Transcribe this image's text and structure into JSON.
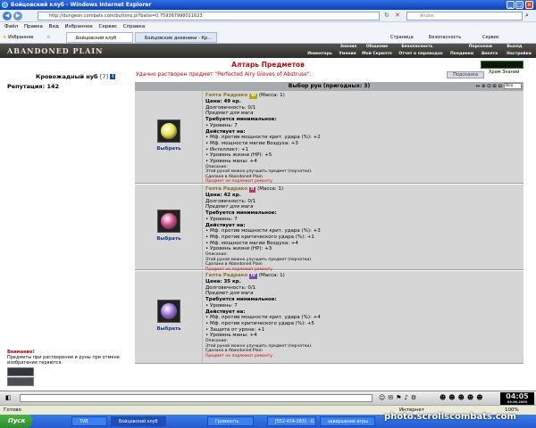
{
  "window": {
    "title": "Бойцовский клуб - Windows Internet Explorer",
    "min": "_",
    "max": "□",
    "close": "✕"
  },
  "address": {
    "url": "http://dungeon.combats.com/buttons.pl?batle=0.759367998011623",
    "search_placeholder": "Яndex"
  },
  "menu": [
    "Файл",
    "Правка",
    "Вид",
    "Избранное",
    "Сервис",
    "Справка"
  ],
  "tabs": {
    "favorites": "Избранное",
    "items": [
      "Бойцовский клуб",
      "Бойцовские дневники - Кр..."
    ]
  },
  "toolbar": {
    "page": "Страница",
    "safety": "Безопасность",
    "service": "Сервис"
  },
  "game": {
    "logo": "ABANDONED PLAIN",
    "nav_top": [
      "Знания",
      "Общение",
      "Безопасность",
      "Персонаж",
      "Выход"
    ],
    "nav_bottom": [
      "Инвентарь",
      "Умения",
      "Мой Скриптп",
      "Отчет о переводах",
      "Поединки",
      "Анкета",
      "Настройки"
    ]
  },
  "player": {
    "name": "Кровожадный нуб",
    "level": "[7]",
    "info_icon": "i",
    "reputation": "Репутация: 142"
  },
  "warning": {
    "title": "Внимание!",
    "text": "Предметы при растворении и руны при отмене изобратения теряются."
  },
  "page": {
    "title": "Алтарь Предметов",
    "message": "Удачно растворен предмет \"Perfected Airy Gloves of Abstruse\".",
    "help_button": "Подсказка",
    "zone": "Храм Знаний",
    "list_title": "Выбор рун (пригодных: 3)",
    "list_select": "Все",
    "list_icons": "↔ ⊕ Q ⊞ ⊟"
  },
  "runes": [
    {
      "name": "Гепта Радрако",
      "level_badge": "VI",
      "badge_color": "#b7a416",
      "mass": "(Масса: 1)",
      "price": "Цена: 49 кр.",
      "durability": "Долговечность: 0/1",
      "for_class": "Предмет для мага",
      "req_title": "Требуется минимальное:",
      "reqs": [
        "• Уровень: 7"
      ],
      "acts_title": "Действует на:",
      "effects": [
        "• Мф. против мощности крит. удара (%): +2",
        "• Мф. мощности магии Воздуха: +3",
        "• Интеллект: +1",
        "• Уровень жизни (HP): +5",
        "• Уровень маны: +4"
      ],
      "desc_title": "Описание:",
      "desc": "Этой руной можно улучшить предмет (перчатки).",
      "made": "Сделано в Abandoned Plain",
      "no_repair": "Предмет не подлежит ремонту",
      "choose": "Выбрать",
      "gem_color": "#e6e34a"
    },
    {
      "name": "Гепта Радрако",
      "level_badge": "II",
      "badge_color": "#b23a6c",
      "mass": "(Масса: 1)",
      "price": "Цена: 42 кр.",
      "durability": "Долговечность: 0/1",
      "for_class": "Предмет для мага",
      "req_title": "Требуется минимальное:",
      "reqs": [
        "• Уровень: 7"
      ],
      "acts_title": "Действует на:",
      "effects": [
        "• Мф. против мощности крит. удара (%): +3",
        "• Мф. против критического удара (%): +1",
        "• Мф. мощности магии Воздуха: +4",
        "• Уровень жизни (HP): +3"
      ],
      "desc_title": "Описание:",
      "desc": "Этой руной можно улучшить предмет (перчатки).",
      "made": "Сделано в Abandoned Plain",
      "no_repair": "Предмет не подлежит ремонту",
      "choose": "Выбрать",
      "gem_color": "#d04a8a"
    },
    {
      "name": "Гепта Радрако",
      "level_badge": "IV",
      "badge_color": "#7a4aa8",
      "mass": "(Масса: 1)",
      "price": "Цена: 35 кр.",
      "durability": "Долговечность: 0/1",
      "for_class": "Предмет для мага",
      "req_title": "Требуется минимальное:",
      "reqs": [
        "• Уровень: 7"
      ],
      "acts_title": "Действует на:",
      "effects": [
        "• Мф. против мощности крит. удара (%): +4",
        "• Мф. против критического удара (%): +5",
        "• Защита от урона: +1",
        "• Уровень маны: +4"
      ],
      "desc_title": "Описание:",
      "desc": "Этой руной можно улучшить предмет (перчатки).",
      "made": "Сделано в Abandoned Plain",
      "no_repair": "Предмет не подлежит ремонту",
      "choose": "Выбрать",
      "gem_color": "#9b6fd6"
    }
  ],
  "chat": {
    "time": "04:05",
    "date": "09.06.2009"
  },
  "status": {
    "left": "Готово",
    "zone": "Интернет",
    "zoom": "100%"
  },
  "taskbar": {
    "start": "Пуск",
    "items": [
      "TVR",
      "Бойцовский клуб",
      "Громкость",
      "[552-434-263] - O...",
      "завершение игры"
    ],
    "watermark": "photo.scrollscombats.com"
  },
  "colors": {
    "title_red": "#b01010",
    "link_blue": "#1a3b8c",
    "row_bg": "#d6d6d6"
  }
}
